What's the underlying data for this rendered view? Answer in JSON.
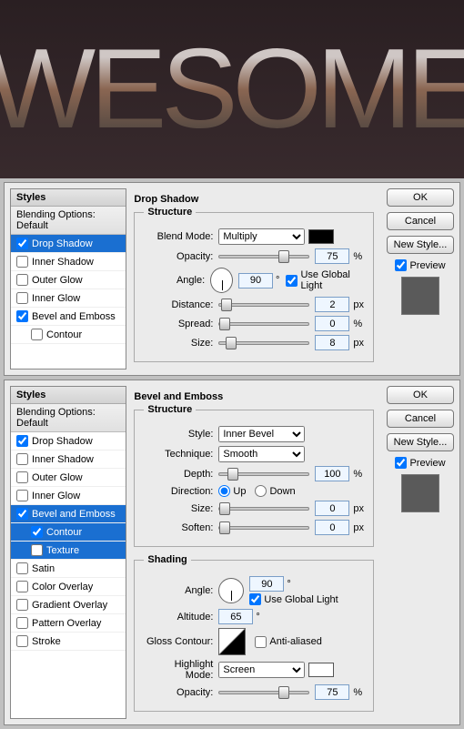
{
  "hero_text": "WESOME",
  "styles_header": "Styles",
  "blending_options": "Blending Options: Default",
  "panel1": {
    "title": "Drop Shadow",
    "structure": "Structure",
    "items": [
      {
        "label": "Drop Shadow",
        "checked": true,
        "sel": true
      },
      {
        "label": "Inner Shadow",
        "checked": false
      },
      {
        "label": "Outer Glow",
        "checked": false
      },
      {
        "label": "Inner Glow",
        "checked": false
      },
      {
        "label": "Bevel and Emboss",
        "checked": true
      },
      {
        "label": "Contour",
        "checked": false,
        "sub": true
      }
    ],
    "fields": {
      "blend_mode_label": "Blend Mode:",
      "blend_mode_value": "Multiply",
      "opacity_label": "Opacity:",
      "opacity_value": "75",
      "opacity_unit": "%",
      "angle_label": "Angle:",
      "angle_value": "90",
      "angle_unit": "°",
      "global_light": "Use Global Light",
      "distance_label": "Distance:",
      "distance_value": "2",
      "distance_unit": "px",
      "spread_label": "Spread:",
      "spread_value": "0",
      "spread_unit": "%",
      "size_label": "Size:",
      "size_value": "8",
      "size_unit": "px"
    },
    "buttons": {
      "ok": "OK",
      "cancel": "Cancel",
      "newstyle": "New Style...",
      "preview": "Preview"
    }
  },
  "panel2": {
    "title": "Bevel and Emboss",
    "structure": "Structure",
    "shading": "Shading",
    "items": [
      {
        "label": "Drop Shadow",
        "checked": true
      },
      {
        "label": "Inner Shadow",
        "checked": false
      },
      {
        "label": "Outer Glow",
        "checked": false
      },
      {
        "label": "Inner Glow",
        "checked": false
      },
      {
        "label": "Bevel and Emboss",
        "checked": true,
        "sel": true
      },
      {
        "label": "Contour",
        "checked": true,
        "sub": true,
        "sel": true
      },
      {
        "label": "Texture",
        "checked": false,
        "sub": true,
        "sel": true
      },
      {
        "label": "Satin",
        "checked": false
      },
      {
        "label": "Color Overlay",
        "checked": false
      },
      {
        "label": "Gradient Overlay",
        "checked": false
      },
      {
        "label": "Pattern Overlay",
        "checked": false
      },
      {
        "label": "Stroke",
        "checked": false
      }
    ],
    "fields": {
      "style_label": "Style:",
      "style_value": "Inner Bevel",
      "technique_label": "Technique:",
      "technique_value": "Smooth",
      "depth_label": "Depth:",
      "depth_value": "100",
      "depth_unit": "%",
      "direction_label": "Direction:",
      "direction_up": "Up",
      "direction_down": "Down",
      "size_label": "Size:",
      "size_value": "0",
      "size_unit": "px",
      "soften_label": "Soften:",
      "soften_value": "0",
      "soften_unit": "px",
      "angle_label": "Angle:",
      "angle_value": "90",
      "angle_unit": "°",
      "global_light": "Use Global Light",
      "altitude_label": "Altitude:",
      "altitude_value": "65",
      "altitude_unit": "°",
      "gloss_label": "Gloss Contour:",
      "anti": "Anti-aliased",
      "highlight_label": "Highlight Mode:",
      "highlight_value": "Screen",
      "opacity_label": "Opacity:",
      "opacity_value": "75",
      "opacity_unit": "%"
    },
    "buttons": {
      "ok": "OK",
      "cancel": "Cancel",
      "newstyle": "New Style...",
      "preview": "Preview"
    }
  }
}
